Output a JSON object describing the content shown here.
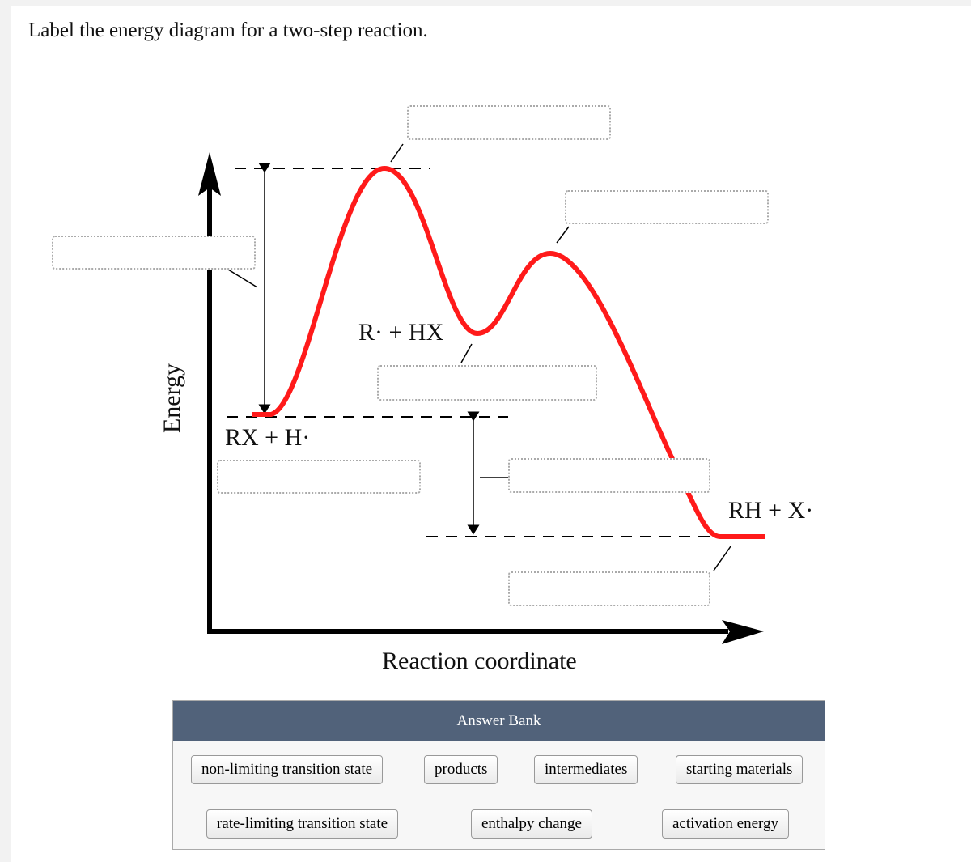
{
  "question": "Label the energy diagram for a two-step reaction.",
  "diagram": {
    "y_axis_label": "Energy",
    "x_axis_label": "Reaction coordinate",
    "species": {
      "reactants": "RX + H·",
      "intermediate": "R· + HX",
      "products": "RH + X·"
    },
    "curve_color": "#ff1a1a",
    "drop_targets": [
      "",
      "",
      "",
      "",
      "",
      "",
      ""
    ]
  },
  "answer_bank": {
    "title": "Answer Bank",
    "header_color": "#51627a",
    "items": [
      "non-limiting transition state",
      "products",
      "intermediates",
      "starting materials",
      "rate-limiting transition state",
      "enthalpy change",
      "activation energy"
    ]
  }
}
